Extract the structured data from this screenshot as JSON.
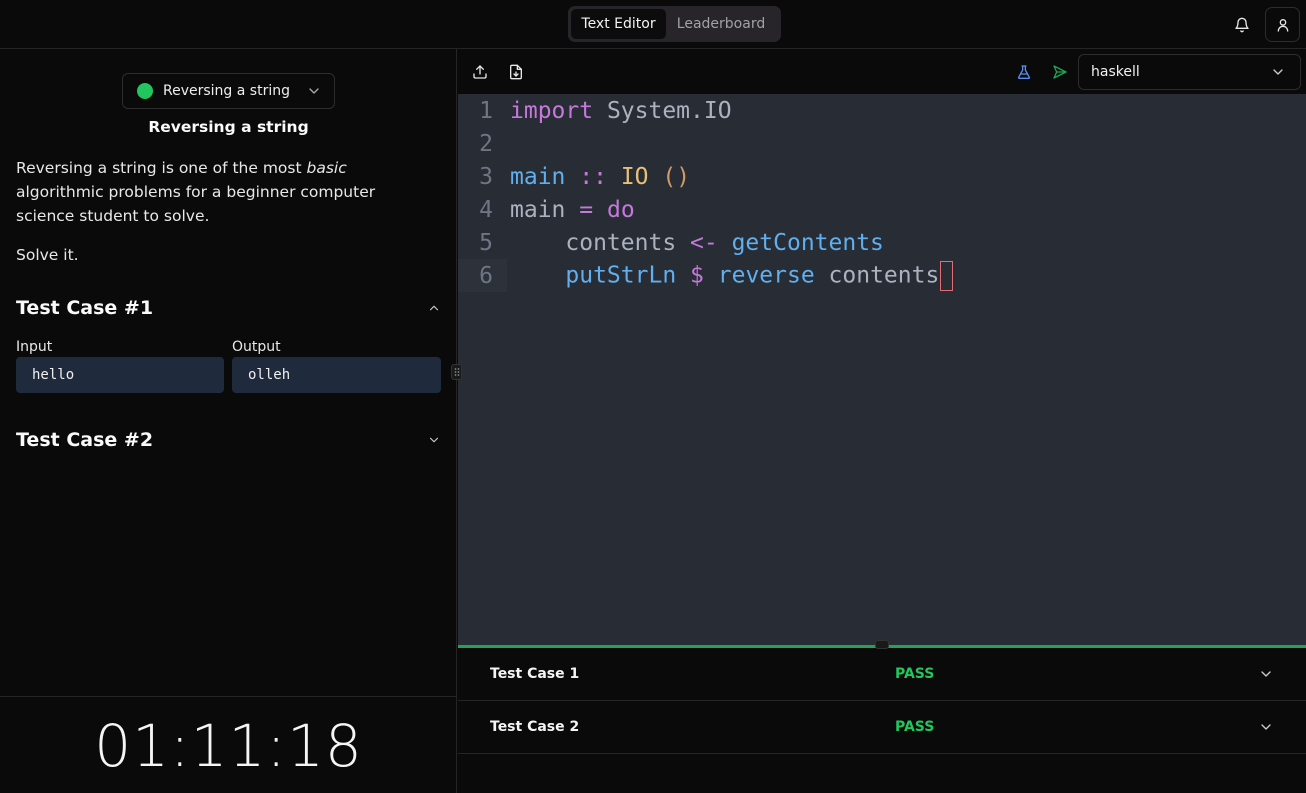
{
  "topbar": {
    "tabs": [
      {
        "label": "Text Editor",
        "active": true
      },
      {
        "label": "Leaderboard",
        "active": false
      }
    ],
    "icons": [
      "bell-icon",
      "user-icon"
    ]
  },
  "problem": {
    "selector_label": "Reversing a string",
    "status_color": "#22c55e",
    "title": "Reversing a string",
    "description_before": "Reversing a string is one of the most ",
    "description_emphasis": "basic",
    "description_after": " algorithmic problems for a beginner computer science student to solve.",
    "instruction": "Solve it."
  },
  "test_cases": [
    {
      "title": "Test Case #1",
      "expanded": true,
      "input_label": "Input",
      "input": "hello",
      "output_label": "Output",
      "output": "olleh"
    },
    {
      "title": "Test Case #2",
      "expanded": false
    }
  ],
  "timer": "01:11:18",
  "editor": {
    "language": "haskell",
    "toolbar_icons": [
      "upload-icon",
      "download-icon",
      "flask-icon",
      "send-icon"
    ],
    "lines": [
      {
        "num": "1",
        "tokens": [
          {
            "t": "import",
            "c": "kw"
          },
          {
            "t": " System.IO",
            "c": "plain"
          }
        ]
      },
      {
        "num": "2",
        "tokens": []
      },
      {
        "num": "3",
        "tokens": [
          {
            "t": "main",
            "c": "fn"
          },
          {
            "t": " ",
            "c": "plain"
          },
          {
            "t": "::",
            "c": "op"
          },
          {
            "t": " ",
            "c": "plain"
          },
          {
            "t": "IO",
            "c": "ty"
          },
          {
            "t": " ",
            "c": "plain"
          },
          {
            "t": "()",
            "c": "par"
          }
        ]
      },
      {
        "num": "4",
        "tokens": [
          {
            "t": "main",
            "c": "plain"
          },
          {
            "t": " ",
            "c": "plain"
          },
          {
            "t": "=",
            "c": "op"
          },
          {
            "t": " ",
            "c": "plain"
          },
          {
            "t": "do",
            "c": "kw"
          }
        ]
      },
      {
        "num": "5",
        "tokens": [
          {
            "t": "    contents ",
            "c": "plain"
          },
          {
            "t": "<-",
            "c": "op"
          },
          {
            "t": " ",
            "c": "plain"
          },
          {
            "t": "getContents",
            "c": "fn"
          }
        ]
      },
      {
        "num": "6",
        "tokens": [
          {
            "t": "    ",
            "c": "plain"
          },
          {
            "t": "putStrLn",
            "c": "fn"
          },
          {
            "t": " ",
            "c": "plain"
          },
          {
            "t": "$",
            "c": "op"
          },
          {
            "t": " ",
            "c": "plain"
          },
          {
            "t": "reverse",
            "c": "fn"
          },
          {
            "t": " contents",
            "c": "plain"
          }
        ],
        "active": true,
        "cursor": true
      }
    ]
  },
  "results": [
    {
      "name": "Test Case 1",
      "status": "PASS"
    },
    {
      "name": "Test Case 2",
      "status": "PASS"
    }
  ],
  "colors": {
    "accent_green": "#22c55e",
    "divider_green": "#22a355",
    "editor_bg": "#282c34"
  }
}
